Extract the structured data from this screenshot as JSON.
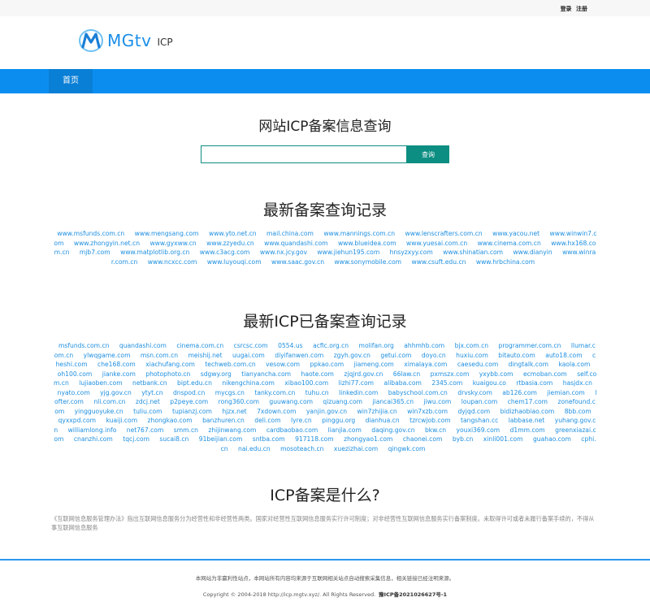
{
  "topbar": {
    "login": "登录",
    "register": "注册"
  },
  "logo": {
    "brand": "MGtv",
    "suffix": "ICP",
    "accent": "#1a8ee9"
  },
  "nav": {
    "home": "首页"
  },
  "search": {
    "title": "网站ICP备案信息查询",
    "button": "查询",
    "value": "",
    "placeholder": ""
  },
  "latest": {
    "title": "最新备案查询记录",
    "links": [
      "www.msfunds.com.cn",
      "www.mengsang.com",
      "www.yto.net.cn",
      "mail.china.com",
      "www.mannings.com.cn",
      "www.lenscrafters.com.cn",
      "www.yacou.net",
      "www.winwin7.com",
      "www.zhongyin.net.cn",
      "www.gyxww.cn",
      "www.zzyedu.cn",
      "www.quandashi.com",
      "www.blueidea.com",
      "www.yuesai.com.cn",
      "www.cinema.com.cn",
      "www.hx168.com.cn",
      "mjb7.com",
      "www.matplotlib.org.cn",
      "www.c3acg.com",
      "www.nx.jcy.gov",
      "www.jiehun195.com",
      "hnsyzxyy.com",
      "www.shinatian.com",
      "www.dianyin",
      "www.winrar.com.cn",
      "www.ncxcc.com",
      "www.luyouqi.com",
      "www.saac.gov.cn",
      "www.sonymobile.com",
      "www.csuft.edu.cn",
      "www.hrbchina.com"
    ]
  },
  "icp": {
    "title": "最新ICP已备案查询记录",
    "links": [
      "msfunds.com.cn",
      "quandashi.com",
      "cinema.com.cn",
      "csrcsc.com",
      "0554.us",
      "acfic.org.cn",
      "molifan.org",
      "ahhmhb.com",
      "bjx.com.cn",
      "programmer.com.cn",
      "llumar.com.cn",
      "ylwqgame.com",
      "msn.com.cn",
      "meishij.net",
      "uugai.com",
      "diyifanwen.com",
      "zgyh.gov.cn",
      "getui.com",
      "doyo.cn",
      "huxiu.com",
      "bitauto.com",
      "auto18.com",
      "cheshi.com",
      "che168.com",
      "xiachufang.com",
      "techweb.com.cn",
      "vesow.com",
      "ppkao.com",
      "jiameng.com",
      "ximalaya.com",
      "caesedu.com",
      "dingtalk.com",
      "kaola.com",
      "oh100.com",
      "jianke.com",
      "photophoto.cn",
      "sdgwy.org",
      "tianyancha.com",
      "haote.com",
      "zjqjrd.gov.cn",
      "66law.cn",
      "pxmszx.com",
      "yxybb.com",
      "ecmoban.com",
      "self.com.cn",
      "lujiaoben.com",
      "netbank.cn",
      "bipt.edu.cn",
      "nikengchina.com",
      "xibao100.com",
      "lizhi77.com",
      "alibaba.com",
      "2345.com",
      "kuaigou.co",
      "rtbasia.com",
      "hasjdx.cn",
      "nyato.com",
      "yjg.gov.cn",
      "ytyt.cn",
      "dnspod.cn",
      "mycgs.cn",
      "tanky.com.cn",
      "tuhu.cn",
      "linkedin.com",
      "babyschool.com.cn",
      "drvsky.com",
      "ab126.com",
      "jiemian.com",
      "lofter.com",
      "nli.com.cn",
      "zdcj.net",
      "p2peye.com",
      "rong360.com",
      "guuwang.com",
      "qizuang.com",
      "jiancai365.cn",
      "jiwu.com",
      "loupan.com",
      "chem17.com",
      "zonefound.com",
      "yingguoyuke.cn",
      "tuliu.com",
      "tupianzj.com",
      "hjzx.net",
      "7xdown.com",
      "yanjin.gov.cn",
      "win7zhijia.cn",
      "win7xzb.com",
      "dyjqd.com",
      "bidizhaobiao.com",
      "8bb.com",
      "qyxxpd.com",
      "kuaiji.com",
      "zhongkao.com",
      "banzhuren.cn",
      "deli.com",
      "lyre.cn",
      "pinggu.org",
      "dianhua.cn",
      "tzrcwjob.com",
      "tangshan.cc",
      "labbase.net",
      "yuhang.gov.cn",
      "williamlong.info",
      "net767.com",
      "smm.cn",
      "zhijinwang.com",
      "cardbaobao.com",
      "lianjia.com",
      "daqing.gov.cn",
      "bkw.cn",
      "youxi369.com",
      "d1mm.com",
      "greenxiazai.com",
      "cnanzhi.com",
      "tqcj.com",
      "sucai8.cn",
      "91beijian.com",
      "sntba.com",
      "917118.com",
      "zhongyao1.com",
      "chaonei.com",
      "byb.cn",
      "xinli001.com",
      "guahao.com",
      "cphi.cn",
      "nai.edu.cn",
      "mosoteach.cn",
      "xuezizhai.com",
      "qingwk.com"
    ]
  },
  "about": {
    "title": "ICP备案是什么?",
    "text": "《互联网信息服务管理办法》指出互联网信息服务分为经营性和非经营性两类。国家对经营性互联网信息服务实行许可制度；对非经营性互联网信息服务实行备案制度。未取得许可或者未履行备案手续的，不得从事互联网信息服务"
  },
  "footer": {
    "notice": "本网站为非赢利性站点，本网站所有内容均来源于互联网相关站点自动搜索采集信息，相关链接已经注明来源。",
    "copyright": "Copyright © 2004-2018 http://icp.mgtv.xyz/. All Rights Reserved.",
    "beian": "豫ICP备2021026627号-1"
  }
}
